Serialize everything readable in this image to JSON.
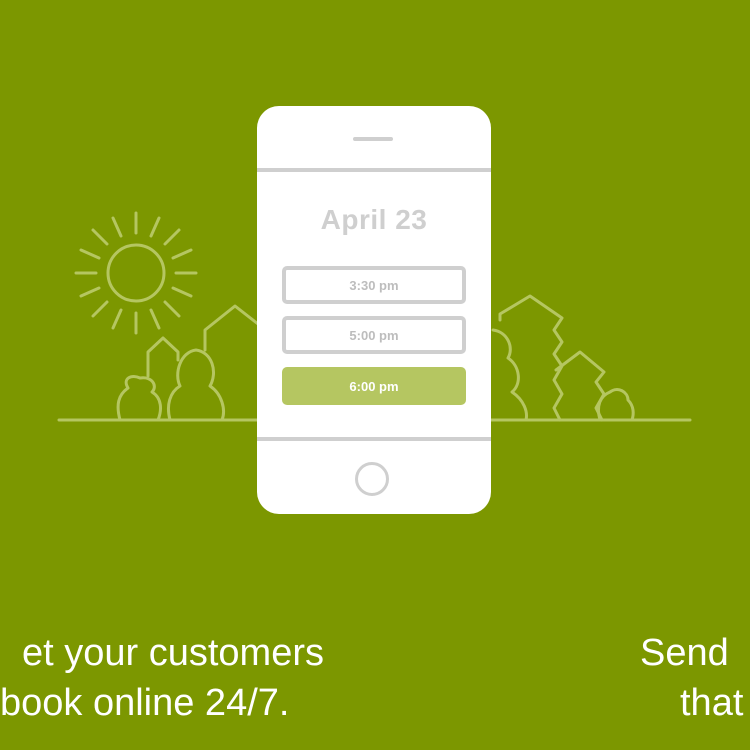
{
  "phone": {
    "date": "April 23",
    "time_slots": [
      {
        "label": "3:30 pm",
        "selected": false
      },
      {
        "label": "5:00 pm",
        "selected": false
      },
      {
        "label": "6:00 pm",
        "selected": true
      }
    ]
  },
  "captions": {
    "left_line1": "et your customers",
    "left_line2": "book online 24/7.",
    "right_line1": "Send",
    "right_line2": "that"
  },
  "colors": {
    "background": "#7c9700",
    "line_art": "#b5c661",
    "phone_body": "#ffffff",
    "phone_gray": "#cfcfcf",
    "selected_slot": "#b5c661"
  },
  "icons": [
    "sun-icon",
    "tree-icon",
    "phone-home-button-icon"
  ]
}
